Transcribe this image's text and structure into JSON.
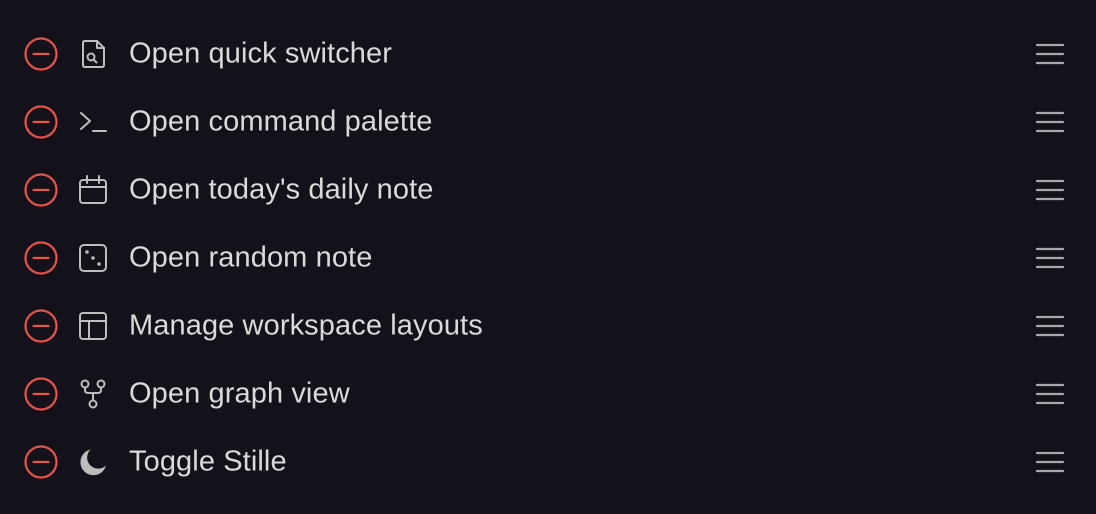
{
  "colors": {
    "background": "#13121a",
    "remove_accent": "#e5534b",
    "icon": "#bdbdbd",
    "label": "#dadada",
    "handle": "#a8a8a8"
  },
  "ribbon_items": [
    {
      "label": "Open quick switcher",
      "icon": "file-search-icon"
    },
    {
      "label": "Open command palette",
      "icon": "terminal-icon"
    },
    {
      "label": "Open today's daily note",
      "icon": "calendar-icon"
    },
    {
      "label": "Open random note",
      "icon": "dice-icon"
    },
    {
      "label": "Manage workspace layouts",
      "icon": "layout-icon"
    },
    {
      "label": "Open graph view",
      "icon": "git-fork-icon"
    },
    {
      "label": "Toggle Stille",
      "icon": "moon-icon"
    }
  ]
}
